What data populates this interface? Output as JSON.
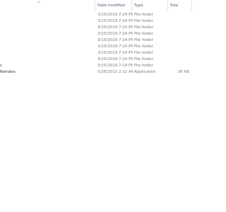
{
  "columns": {
    "date": "Date modified",
    "type": "Type",
    "size": "Size"
  },
  "icons": {
    "sort": "sort-ascending-chevron-icon"
  },
  "rows": [
    {
      "name": "",
      "date": "3/15/2019 7:24 PM",
      "type": "File folder",
      "size": ""
    },
    {
      "name": "",
      "date": "3/15/2019 7:24 PM",
      "type": "File folder",
      "size": ""
    },
    {
      "name": "",
      "date": "3/15/2019 7:24 PM",
      "type": "File folder",
      "size": ""
    },
    {
      "name": "",
      "date": "3/15/2019 7:24 PM",
      "type": "File folder",
      "size": ""
    },
    {
      "name": "",
      "date": "3/15/2019 7:24 PM",
      "type": "File folder",
      "size": ""
    },
    {
      "name": "",
      "date": "3/15/2019 7:24 PM",
      "type": "File folder",
      "size": ""
    },
    {
      "name": "",
      "date": "3/15/2019 7:24 PM",
      "type": "File folder",
      "size": ""
    },
    {
      "name": "",
      "date": "3/15/2019 7:24 PM",
      "type": "File folder",
      "size": ""
    },
    {
      "name": "s",
      "date": "3/15/2019 7:24 PM",
      "type": "File folder",
      "size": ""
    },
    {
      "name": "Relndex",
      "date": "5/28/2011 2:32 AM",
      "type": "Application",
      "size": "36 KB"
    }
  ]
}
